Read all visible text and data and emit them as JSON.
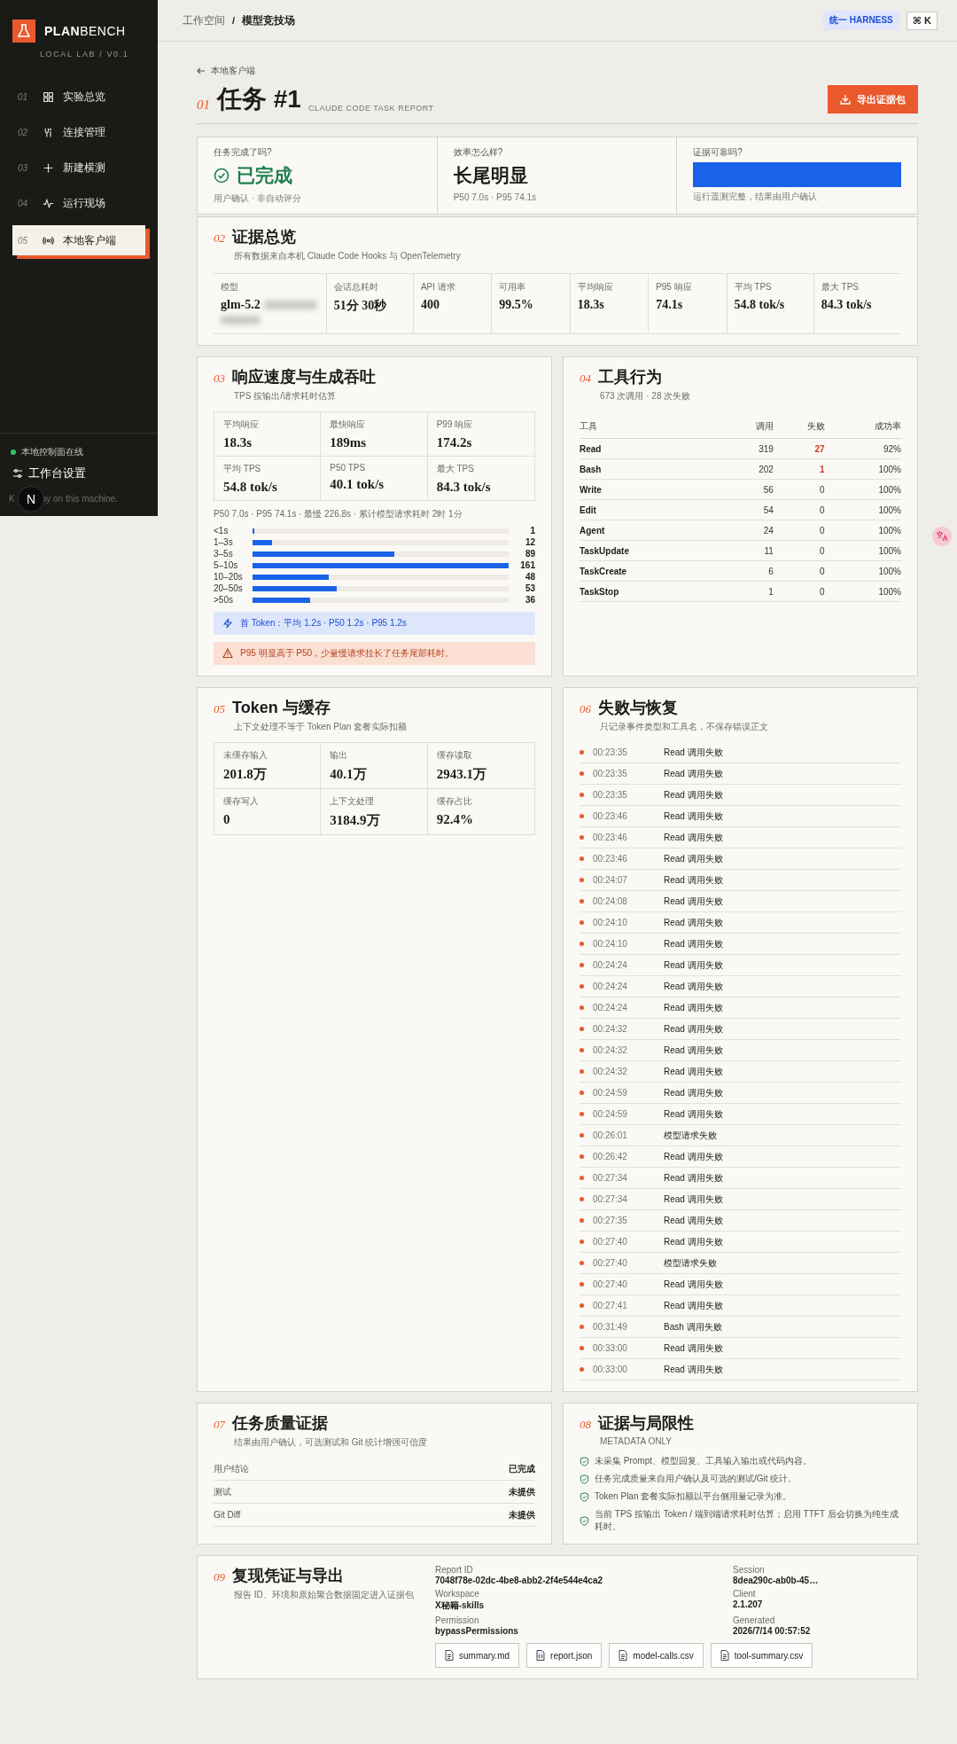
{
  "sidebar": {
    "brand_bold": "PLAN",
    "brand_rest": "BENCH",
    "version": "LOCAL LAB / V0.1",
    "items": [
      {
        "num": "01",
        "label": "实验总览",
        "kind": "grid",
        "selected": false
      },
      {
        "num": "02",
        "label": "连接管理",
        "kind": "connector",
        "selected": false
      },
      {
        "num": "03",
        "label": "新建横测",
        "kind": "plus",
        "selected": false
      },
      {
        "num": "04",
        "label": "运行现场",
        "kind": "pulse",
        "selected": false
      },
      {
        "num": "05",
        "label": "本地客户端",
        "kind": "broadcast",
        "selected": true
      }
    ],
    "status": {
      "label": "本地控制面在线",
      "online": true
    },
    "settings": "工作台设置",
    "note_start": "K",
    "note_end": "ay on this machine."
  },
  "dev_badge": "N",
  "topbar": {
    "breadcrumb": [
      "工作空间",
      "模型竞技场"
    ],
    "separator": "/",
    "badge": "统一 HARNESS",
    "shortcut": "⌘ K"
  },
  "back_link": "本地客户端",
  "title": {
    "num": "01",
    "text": "任务 #1",
    "subtitle": "CLAUDE CODE TASK REPORT"
  },
  "export_button": "导出证据包",
  "summary": [
    {
      "question": "任务完成了吗?",
      "kind": "status",
      "value": "已完成",
      "note": "用户确认 · 非自动评分"
    },
    {
      "question": "效率怎么样?",
      "kind": "text",
      "value": "长尾明显",
      "note": "P50 7.0s · P95 74.1s"
    },
    {
      "question": "证据可靠吗?",
      "kind": "bar",
      "level": 1,
      "note": "运行遥测完整，结果由用户确认"
    }
  ],
  "evidence": {
    "num": "02",
    "title": "证据总览",
    "subtitle": "所有数据来自本机 Claude Code Hooks 与 OpenTelemetry",
    "stats": [
      {
        "label": "模型",
        "value": "glm-5.2",
        "redacted": true
      },
      {
        "label": "会话总耗时",
        "value": "51分 30秒",
        "redacted": false
      },
      {
        "label": "API 请求",
        "value": "400",
        "redacted": false
      },
      {
        "label": "可用率",
        "value": "99.5%",
        "redacted": false
      },
      {
        "label": "平均响应",
        "value": "18.3s",
        "redacted": false
      },
      {
        "label": "P95 响应",
        "value": "74.1s",
        "redacted": false
      },
      {
        "label": "平均 TPS",
        "value": "54.8 tok/s",
        "redacted": false
      },
      {
        "label": "最大 TPS",
        "value": "84.3 tok/s",
        "redacted": false
      }
    ]
  },
  "speed": {
    "num": "03",
    "title": "响应速度与生成吞吐",
    "subtitle": "TPS 按输出/请求耗时估算",
    "stats": [
      {
        "label": "平均响应",
        "value": "18.3s"
      },
      {
        "label": "最快响应",
        "value": "189ms"
      },
      {
        "label": "P99 响应",
        "value": "174.2s"
      },
      {
        "label": "平均 TPS",
        "value": "54.8 tok/s"
      },
      {
        "label": "P50 TPS",
        "value": "40.1 tok/s"
      },
      {
        "label": "最大 TPS",
        "value": "84.3 tok/s"
      }
    ],
    "note": "P50 7.0s · P95 74.1s · 最慢 226.8s · 累计模型请求耗时 2时 1分",
    "chart_data": {
      "type": "bar",
      "orientation": "horizontal",
      "categories": [
        "<1s",
        "1–3s",
        "3–5s",
        "5–10s",
        "10–20s",
        "20–50s",
        ">50s"
      ],
      "values": [
        1,
        12,
        89,
        161,
        48,
        53,
        36
      ],
      "data_labels": true
    },
    "alerts": [
      {
        "kind": "info",
        "text": "首 Token：平均 1.2s · P50 1.2s · P95 1.2s"
      },
      {
        "kind": "warning",
        "text": "P95 明显高于 P50，少量慢请求拉长了任务尾部耗时。"
      }
    ]
  },
  "tools": {
    "num": "04",
    "title": "工具行为",
    "subtitle": "673 次调用 · 28 次失败",
    "columns": [
      "工具",
      "调用",
      "失败",
      "成功率"
    ],
    "rows": [
      {
        "tool": "Read",
        "calls": "319",
        "failures": "27",
        "rate": "92%",
        "flagged": true
      },
      {
        "tool": "Bash",
        "calls": "202",
        "failures": "1",
        "rate": "100%",
        "flagged": true
      },
      {
        "tool": "Write",
        "calls": "56",
        "failures": "0",
        "rate": "100%",
        "flagged": false
      },
      {
        "tool": "Edit",
        "calls": "54",
        "failures": "0",
        "rate": "100%",
        "flagged": false
      },
      {
        "tool": "Agent",
        "calls": "24",
        "failures": "0",
        "rate": "100%",
        "flagged": false
      },
      {
        "tool": "TaskUpdate",
        "calls": "11",
        "failures": "0",
        "rate": "100%",
        "flagged": false
      },
      {
        "tool": "TaskCreate",
        "calls": "6",
        "failures": "0",
        "rate": "100%",
        "flagged": false
      },
      {
        "tool": "TaskStop",
        "calls": "1",
        "failures": "0",
        "rate": "100%",
        "flagged": false
      }
    ]
  },
  "tokens": {
    "num": "05",
    "title": "Token 与缓存",
    "subtitle": "上下文处理不等于 Token Plan 套餐实际扣额",
    "stats": [
      {
        "label": "未缓存输入",
        "value": "201.8万"
      },
      {
        "label": "输出",
        "value": "40.1万"
      },
      {
        "label": "缓存读取",
        "value": "2943.1万"
      },
      {
        "label": "缓存写入",
        "value": "0"
      },
      {
        "label": "上下文处理",
        "value": "3184.9万"
      },
      {
        "label": "缓存占比",
        "value": "92.4%"
      }
    ]
  },
  "failures": {
    "num": "06",
    "title": "失败与恢复",
    "subtitle": "只记录事件类型和工具名，不保存错误正文",
    "events": [
      {
        "time": "00:23:35",
        "text": "Read 调用失败"
      },
      {
        "time": "00:23:35",
        "text": "Read 调用失败"
      },
      {
        "time": "00:23:35",
        "text": "Read 调用失败"
      },
      {
        "time": "00:23:46",
        "text": "Read 调用失败"
      },
      {
        "time": "00:23:46",
        "text": "Read 调用失败"
      },
      {
        "time": "00:23:46",
        "text": "Read 调用失败"
      },
      {
        "time": "00:24:07",
        "text": "Read 调用失败"
      },
      {
        "time": "00:24:08",
        "text": "Read 调用失败"
      },
      {
        "time": "00:24:10",
        "text": "Read 调用失败"
      },
      {
        "time": "00:24:10",
        "text": "Read 调用失败"
      },
      {
        "time": "00:24:24",
        "text": "Read 调用失败"
      },
      {
        "time": "00:24:24",
        "text": "Read 调用失败"
      },
      {
        "time": "00:24:24",
        "text": "Read 调用失败"
      },
      {
        "time": "00:24:32",
        "text": "Read 调用失败"
      },
      {
        "time": "00:24:32",
        "text": "Read 调用失败"
      },
      {
        "time": "00:24:32",
        "text": "Read 调用失败"
      },
      {
        "time": "00:24:59",
        "text": "Read 调用失败"
      },
      {
        "time": "00:24:59",
        "text": "Read 调用失败"
      },
      {
        "time": "00:26:01",
        "text": "模型请求失败"
      },
      {
        "time": "00:26:42",
        "text": "Read 调用失败"
      },
      {
        "time": "00:27:34",
        "text": "Read 调用失败"
      },
      {
        "time": "00:27:34",
        "text": "Read 调用失败"
      },
      {
        "time": "00:27:35",
        "text": "Read 调用失败"
      },
      {
        "time": "00:27:40",
        "text": "Read 调用失败"
      },
      {
        "time": "00:27:40",
        "text": "模型请求失败"
      },
      {
        "time": "00:27:40",
        "text": "Read 调用失败"
      },
      {
        "time": "00:27:41",
        "text": "Read 调用失败"
      },
      {
        "time": "00:31:49",
        "text": "Bash 调用失败"
      },
      {
        "time": "00:33:00",
        "text": "Read 调用失败"
      },
      {
        "time": "00:33:00",
        "text": "Read 调用失败"
      }
    ]
  },
  "quality": {
    "num": "07",
    "title": "任务质量证据",
    "subtitle": "结果由用户确认，可选测试和 Git 统计增强可信度",
    "rows": [
      {
        "label": "用户结论",
        "value": "已完成"
      },
      {
        "label": "测试",
        "value": "未提供"
      },
      {
        "label": "Git Diff",
        "value": "未提供"
      }
    ]
  },
  "limits": {
    "num": "08",
    "title": "证据与局限性",
    "subtitle": "METADATA ONLY",
    "items": [
      "未采集 Prompt、模型回复、工具输入输出或代码内容。",
      "任务完成质量来自用户确认及可选的测试/Git 统计。",
      "Token Plan 套餐实际扣额以平台侧用量记录为准。",
      "当前 TPS 按输出 Token / 端到端请求耗时估算；启用 TTFT 后会切换为纯生成耗时。"
    ]
  },
  "export": {
    "num": "09",
    "title": "复现凭证与导出",
    "subtitle": "报告 ID、环境和原始聚合数据固定进入证据包",
    "meta": [
      {
        "label": "Report ID",
        "value": "7048f78e-02dc-4be8-abb2-2f4e544e4ca2"
      },
      {
        "label": "Session",
        "value": "8dea290c-ab0b-45…"
      },
      {
        "label": "Workspace",
        "value": "X秘籍-skills"
      },
      {
        "label": "Client",
        "value": "2.1.207"
      },
      {
        "label": "Permission",
        "value": "bypassPermissions"
      },
      {
        "label": "Generated",
        "value": "2026/7/14 00:57:52"
      }
    ],
    "files": [
      {
        "name": "summary.md",
        "kind": "doc"
      },
      {
        "name": "report.json",
        "kind": "code"
      },
      {
        "name": "model-calls.csv",
        "kind": "doc"
      },
      {
        "name": "tool-summary.csv",
        "kind": "doc"
      }
    ]
  }
}
